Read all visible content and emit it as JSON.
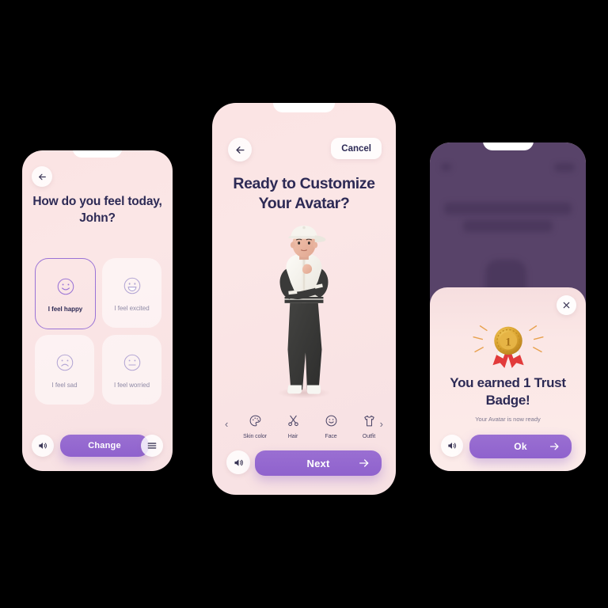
{
  "screen1": {
    "back_icon": "arrow-left-icon",
    "title": "How do you feel today, John?",
    "moods": [
      {
        "id": "happy",
        "label": "I feel happy",
        "icon": "smiley-happy-icon",
        "selected": true
      },
      {
        "id": "excited",
        "label": "I feel excited",
        "icon": "smiley-excited-icon",
        "selected": false
      },
      {
        "id": "sad",
        "label": "I feel sad",
        "icon": "smiley-sad-icon",
        "selected": false
      },
      {
        "id": "worried",
        "label": "I feel worried",
        "icon": "smiley-neutral-icon",
        "selected": false
      }
    ],
    "sound_icon": "speaker-icon",
    "primary_button": "Change",
    "menu_icon": "hamburger-menu-icon"
  },
  "screen2": {
    "back_icon": "arrow-left-icon",
    "cancel_label": "Cancel",
    "title": "Ready to Customize Your Avatar?",
    "avatar_alt": "3d-avatar-character",
    "prev_icon": "chevron-left-icon",
    "next_icon": "chevron-right-icon",
    "categories": [
      {
        "label": "Skin color",
        "icon": "palette-icon"
      },
      {
        "label": "Hair",
        "icon": "scissors-icon"
      },
      {
        "label": "Face",
        "icon": "smiley-face-icon"
      },
      {
        "label": "Outfit",
        "icon": "tshirt-icon"
      }
    ],
    "sound_icon": "speaker-icon",
    "primary_button": "Next",
    "primary_button_icon": "arrow-right-icon"
  },
  "screen3": {
    "close_icon": "close-x-icon",
    "badge_icon": "award-medal-icon",
    "badge_number": "1",
    "title": "You earned 1 Trust Badge!",
    "subtitle": "Your Avatar is now ready",
    "sound_icon": "speaker-icon",
    "primary_button": "Ok",
    "primary_button_icon": "arrow-right-icon"
  },
  "colors": {
    "accent_purple": "#9a6fd2",
    "screen_pink": "#fbe4e4",
    "title_navy": "#2d2a55",
    "muted_text": "#8f8aa6",
    "overlay_purple": "#584369",
    "medal_gold": "#d9a22b",
    "ribbon_red": "#e23b3b"
  }
}
